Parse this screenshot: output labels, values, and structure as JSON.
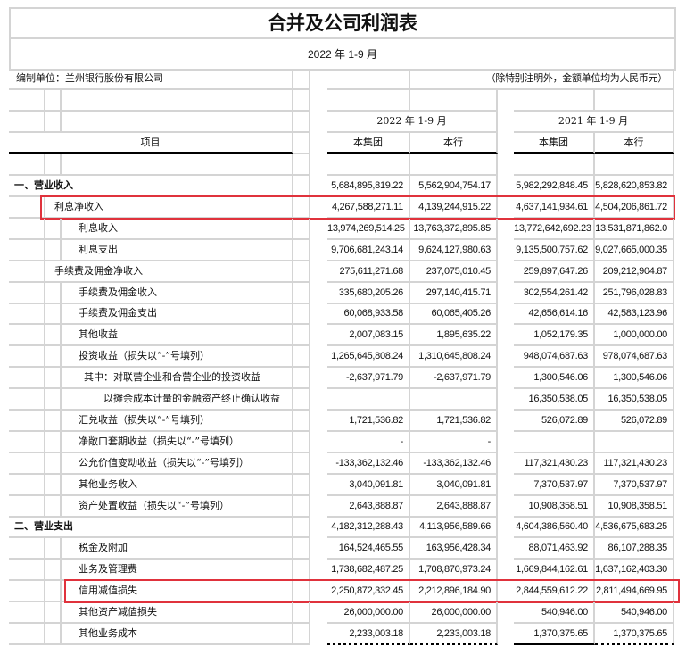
{
  "title": "合并及公司利润表",
  "period": "2022 年 1-9 月",
  "compiler": "编制单位：兰州银行股份有限公司",
  "unit_note": "（除特别注明外，金额单位均为人民币元）",
  "header": {
    "item": "项目",
    "year_current": "2022 年 1-9 月",
    "year_prior": "2021 年 1-9 月",
    "group": "本集团",
    "bank": "本行"
  },
  "highlight_color": "#e0323c",
  "rows": [
    {
      "label": "一、营业收入",
      "level": 0,
      "bold": true,
      "values": [
        "5,684,895,819.22",
        "5,562,904,754.17",
        "5,982,292,848.45",
        "5,828,620,853.82"
      ]
    },
    {
      "label": "利息净收入",
      "level": 1,
      "highlight": true,
      "values": [
        "4,267,588,271.11",
        "4,139,244,915.22",
        "4,637,141,934.61",
        "4,504,206,861.72"
      ]
    },
    {
      "label": "利息收入",
      "level": 2,
      "values": [
        "13,974,269,514.25",
        "13,763,372,895.85",
        "13,772,642,692.23",
        "13,531,871,862.0"
      ]
    },
    {
      "label": "利息支出",
      "level": 2,
      "values": [
        "9,706,681,243.14",
        "9,624,127,980.63",
        "9,135,500,757.62",
        "9,027,665,000.35"
      ]
    },
    {
      "label": "手续费及佣金净收入",
      "level": 1,
      "values": [
        "275,611,271.68",
        "237,075,010.45",
        "259,897,647.26",
        "209,212,904.87"
      ]
    },
    {
      "label": "手续费及佣金收入",
      "level": 2,
      "values": [
        "335,680,205.26",
        "297,140,415.71",
        "302,554,261.42",
        "251,796,028.83"
      ]
    },
    {
      "label": "手续费及佣金支出",
      "level": 2,
      "values": [
        "60,068,933.58",
        "60,065,405.26",
        "42,656,614.16",
        "42,583,123.96"
      ]
    },
    {
      "label": "其他收益",
      "level": 2,
      "values": [
        "2,007,083.15",
        "1,895,635.22",
        "1,052,179.35",
        "1,000,000.00"
      ]
    },
    {
      "label": "投资收益（损失以“-”号填列）",
      "level": 2,
      "values": [
        "1,265,645,808.24",
        "1,310,645,808.24",
        "948,074,687.63",
        "978,074,687.63"
      ]
    },
    {
      "label": "其中：对联营企业和合营企业的投资收益",
      "level": 3,
      "values": [
        "-2,637,971.79",
        "-2,637,971.79",
        "1,300,546.06",
        "1,300,546.06"
      ]
    },
    {
      "label": "以摊余成本计量的金融资产终止确认收益",
      "level": 4,
      "values": [
        "",
        "",
        "16,350,538.05",
        "16,350,538.05"
      ]
    },
    {
      "label": "汇兑收益（损失以“-”号填列）",
      "level": 2,
      "values": [
        "1,721,536.82",
        "1,721,536.82",
        "526,072.89",
        "526,072.89"
      ]
    },
    {
      "label": "净敞口套期收益（损失以“-”号填列）",
      "level": 2,
      "values": [
        "-",
        "-",
        "",
        ""
      ]
    },
    {
      "label": "公允价值变动收益（损失以“-”号填列）",
      "level": 2,
      "values": [
        "-133,362,132.46",
        "-133,362,132.46",
        "117,321,430.23",
        "117,321,430.23"
      ]
    },
    {
      "label": "其他业务收入",
      "level": 2,
      "values": [
        "3,040,091.81",
        "3,040,091.81",
        "7,370,537.97",
        "7,370,537.97"
      ]
    },
    {
      "label": "资产处置收益（损失以“-”号填列）",
      "level": 2,
      "values": [
        "2,643,888.87",
        "2,643,888.87",
        "10,908,358.51",
        "10,908,358.51"
      ]
    },
    {
      "label": "二、营业支出",
      "level": 0,
      "bold": true,
      "values": [
        "4,182,312,288.43",
        "4,113,956,589.66",
        "4,604,386,560.40",
        "4,536,675,683.25"
      ]
    },
    {
      "label": "税金及附加",
      "level": 2,
      "values": [
        "164,524,465.55",
        "163,956,428.34",
        "88,071,463.92",
        "86,107,288.35"
      ]
    },
    {
      "label": "业务及管理费",
      "level": 2,
      "values": [
        "1,738,682,487.25",
        "1,708,870,973.24",
        "1,669,844,162.61",
        "1,637,162,403.30"
      ]
    },
    {
      "label": "信用减值损失",
      "level": 2,
      "highlight": true,
      "values": [
        "2,250,872,332.45",
        "2,212,896,184.90",
        "2,844,559,612.22",
        "2,811,494,669.95"
      ]
    },
    {
      "label": "其他资产减值损失",
      "level": 2,
      "values": [
        "26,000,000.00",
        "26,000,000.00",
        "540,946.00",
        "540,946.00"
      ]
    },
    {
      "label": "其他业务成本",
      "level": 2,
      "values": [
        "2,233,003.18",
        "2,233,003.18",
        "1,370,375.65",
        "1,370,375.65"
      ]
    }
  ]
}
